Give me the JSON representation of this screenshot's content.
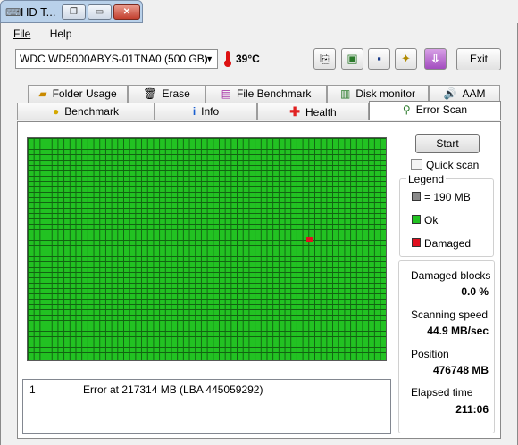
{
  "window": {
    "title": "HD T..."
  },
  "menu": {
    "file": "File",
    "help": "Help"
  },
  "disk": {
    "selected": "WDC WD5000ABYS-01TNA0 (500 GB)"
  },
  "temperature": "39°C",
  "toolbar": {
    "exit_label": "Exit"
  },
  "tabs_top": [
    {
      "label": "Folder Usage",
      "icon": "folder-icon"
    },
    {
      "label": "Erase",
      "icon": "trash-icon"
    },
    {
      "label": "File Benchmark",
      "icon": "file-benchmark-icon"
    },
    {
      "label": "Disk monitor",
      "icon": "monitor-icon"
    },
    {
      "label": "AAM",
      "icon": "speaker-icon"
    }
  ],
  "tabs_bottom": [
    {
      "label": "Benchmark",
      "icon": "bulb-icon"
    },
    {
      "label": "Info",
      "icon": "info-icon"
    },
    {
      "label": "Health",
      "icon": "health-cross-icon"
    },
    {
      "label": "Error Scan",
      "icon": "magnifier-icon",
      "active": true
    }
  ],
  "scan": {
    "start_label": "Start",
    "quick_scan_label": "Quick scan",
    "quick_scan_checked": false,
    "legend": {
      "title": "Legend",
      "block_size": "= 190 MB",
      "ok": "Ok",
      "damaged": "Damaged"
    },
    "colors": {
      "ok": "#22c222",
      "damaged": "#e01020",
      "grid_line": "#126312"
    },
    "stats": {
      "damaged_blocks_label": "Damaged blocks",
      "damaged_blocks_value": "0.0 %",
      "speed_label": "Scanning speed",
      "speed_value": "44.9 MB/sec",
      "position_label": "Position",
      "position_value": "476748 MB",
      "elapsed_label": "Elapsed time",
      "elapsed_value": "211:06"
    },
    "log": [
      {
        "num": "1",
        "text": "Error at 217314 MB (LBA 445059292)"
      }
    ]
  }
}
